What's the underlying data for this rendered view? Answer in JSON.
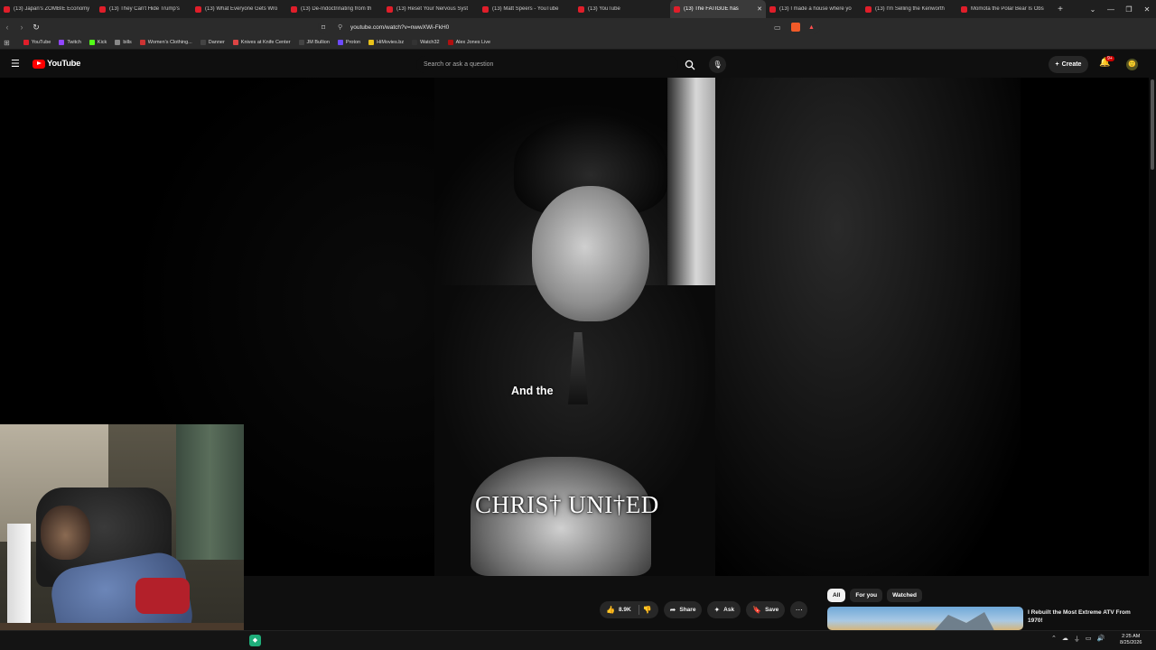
{
  "browser": {
    "tabs": [
      {
        "label": "(13) Japan's ZOMBIE Economy",
        "active": false
      },
      {
        "label": "(13) They Can't Hide Trump's",
        "active": false
      },
      {
        "label": "(13) What Everyone Gets Wro",
        "active": false
      },
      {
        "label": "(13) De-Indoctrinating from th",
        "active": false
      },
      {
        "label": "(13) Reset Your Nervous Syst",
        "active": false
      },
      {
        "label": "(13) Matt Speers - YouTube",
        "active": false
      },
      {
        "label": "(13) YouTube",
        "active": false
      },
      {
        "label": "(13) The FATIGUE has",
        "active": true
      },
      {
        "label": "(13) I made a house where yo",
        "active": false
      },
      {
        "label": "(13) I'm Selling the Kenworth",
        "active": false
      },
      {
        "label": "Momota the Polar Bear Is Obs",
        "active": false
      }
    ],
    "new_tab": "+",
    "url": "youtube.com/watch?v=nwwXWi-FkH0",
    "bookmarks": [
      {
        "label": "YouTube",
        "color": "#e01e2a"
      },
      {
        "label": "Twitch",
        "color": "#9146ff"
      },
      {
        "label": "Kick",
        "color": "#53fc18"
      },
      {
        "label": "bills",
        "color": "#888888"
      },
      {
        "label": "Women's Clothing...",
        "color": "#c33"
      },
      {
        "label": "Danner",
        "color": "#444444"
      },
      {
        "label": "Knives at Knife Center",
        "color": "#d44"
      },
      {
        "label": "JM Bullion",
        "color": "#444444"
      },
      {
        "label": "Proton",
        "color": "#6d4aff"
      },
      {
        "label": "HiMovies.bz",
        "color": "#e8c21a"
      },
      {
        "label": "Watch32",
        "color": "#333333"
      },
      {
        "label": "Alex Jones Live",
        "color": "#b01010"
      }
    ]
  },
  "youtube": {
    "logo_text": "YouTube",
    "search_placeholder": "Search or ask a question",
    "create_label": "Create",
    "notification_count": "9+",
    "video": {
      "caption": "And the",
      "overlay_title": "CHRIS† UNI†ED"
    },
    "actions": {
      "like_count": "8.9K",
      "share_label": "Share",
      "ask_label": "Ask",
      "save_label": "Save"
    },
    "chips": [
      "All",
      "For you",
      "Watched"
    ],
    "recommendation": {
      "title": "I Rebuilt the Most Extreme ATV From 1970!"
    }
  },
  "taskbar": {
    "time": "2:25 AM",
    "date": "8/25/2026"
  }
}
